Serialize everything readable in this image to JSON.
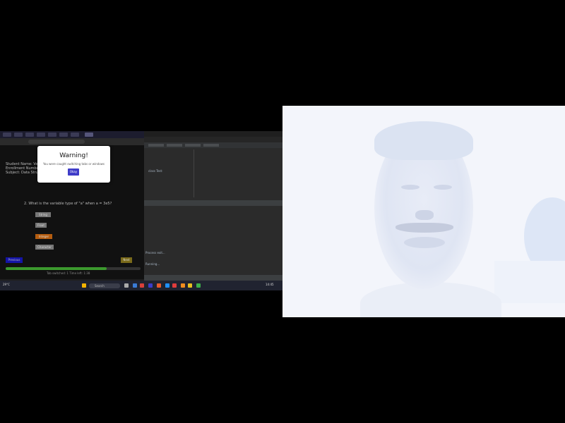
{
  "quiz": {
    "student_lines": [
      "Student Name: Vel...",
      "Enrollment Number...",
      "Subject: Data Stru..."
    ],
    "question": "2. What is the variable type of \"a\" when a = 3e5?",
    "options": [
      "String",
      "Float",
      "Integer",
      "Character"
    ],
    "selected_option": "Integer",
    "prev_label": "Previous",
    "next_label": "Next",
    "progress_fraction": 0.75,
    "status_line": "Tab switched: 1   Time left: 1:38"
  },
  "warning_modal": {
    "title": "Warning!",
    "message": "You were caught switching tabs or windows",
    "ok_label": "Okay"
  },
  "ide": {
    "editor_line": "class Test:",
    "run_lines": [
      "Process exit...",
      "Running..."
    ]
  },
  "taskbar": {
    "weather": "29°C",
    "search_placeholder": "Search",
    "clock": "14:45"
  },
  "colors": {
    "modal_button": "#3f3cc8",
    "prev_button": "#1414a8",
    "next_button": "#7a6a1a",
    "progress_fill": "#3c9a2e",
    "selected_option": "#b55d10"
  },
  "icons": [
    "search-icon",
    "windows-start-icon",
    "webcam-feed"
  ]
}
